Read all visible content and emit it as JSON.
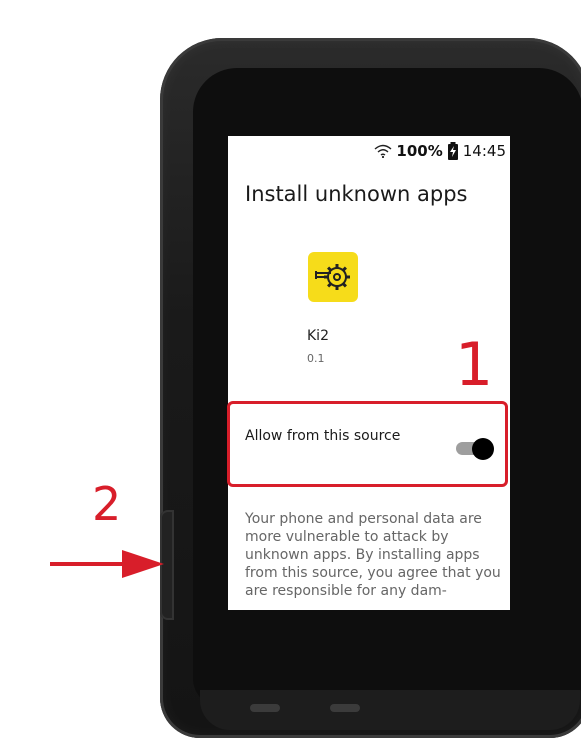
{
  "status_bar": {
    "wifi_icon": "wifi-icon",
    "battery_percent": "100%",
    "battery_icon": "battery-charging-icon",
    "time": "14:45"
  },
  "screen": {
    "title": "Install unknown apps",
    "app": {
      "icon": "sprocket-app-icon",
      "icon_color": "#f6dc1a",
      "name": "Ki2",
      "version": "0.1"
    },
    "allow_source": {
      "label": "Allow from this source",
      "toggle_on": true
    },
    "warning": "Your phone and personal data are more vulnerable to attack by unknown apps. By installing apps from this source, you agree that you are responsible for any dam-"
  },
  "annotations": {
    "callout_1": "1",
    "callout_2": "2",
    "accent_color": "#d81e2a"
  }
}
